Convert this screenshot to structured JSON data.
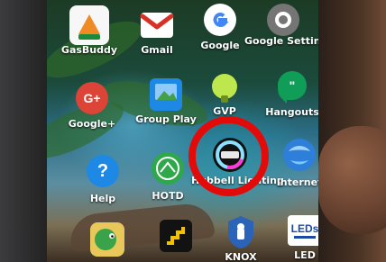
{
  "apps": [
    {
      "name": "GasBuddy",
      "label": "GasBuddy",
      "icon": "gasbuddy-icon",
      "bg": "#f2f2f2"
    },
    {
      "name": "Gmail",
      "label": "Gmail",
      "icon": "gmail-icon",
      "bg": "#ffffff"
    },
    {
      "name": "Google",
      "label": "Google",
      "icon": "google-icon",
      "bg": "#ffffff"
    },
    {
      "name": "Google Settings",
      "label": "Google Settings",
      "icon": "google-settings-icon",
      "bg": "#7a7a7a"
    },
    {
      "name": "Google+",
      "label": "Google+",
      "icon": "google-plus-icon",
      "bg": "#db4437"
    },
    {
      "name": "Group Play",
      "label": "Group Play",
      "icon": "group-play-icon",
      "bg": "#1e88e5"
    },
    {
      "name": "GVP...IoT",
      "label": "GVP",
      "icon": "gvp-iot-icon",
      "bg": "#bde74d"
    },
    {
      "name": "Hangouts",
      "label": "Hangouts",
      "icon": "hangouts-icon",
      "bg": "#0f9d58"
    },
    {
      "name": "Help",
      "label": "Help",
      "icon": "help-icon",
      "bg": "#1e88e5"
    },
    {
      "name": "HOTD",
      "label": "HOTD",
      "icon": "hotd-icon",
      "bg": "#2ea84a"
    },
    {
      "name": "Hubbell Lighting",
      "label": "Hubbell Lighting",
      "icon": "hubbell-lighting-icon",
      "bg": "#111111"
    },
    {
      "name": "Internet",
      "label": "Internet",
      "icon": "internet-icon",
      "bg": "#2d7fd9"
    },
    {
      "name": "Bottom1",
      "label": "",
      "icon": "dinosaur-icon",
      "bg": "#e8c85a"
    },
    {
      "name": "Bottom2",
      "label": "",
      "icon": "stairs-icon",
      "bg": "#121212"
    },
    {
      "name": "KNOX",
      "label": "KNOX",
      "icon": "knox-icon",
      "bg": "#2a63b8"
    },
    {
      "name": "LEDs Magazine",
      "label": "LED",
      "icon": "leds-magazine-icon",
      "bg": "#ffffff"
    }
  ],
  "highlight": {
    "target": "Hubbell Lighting",
    "color": "#e30a0a"
  }
}
